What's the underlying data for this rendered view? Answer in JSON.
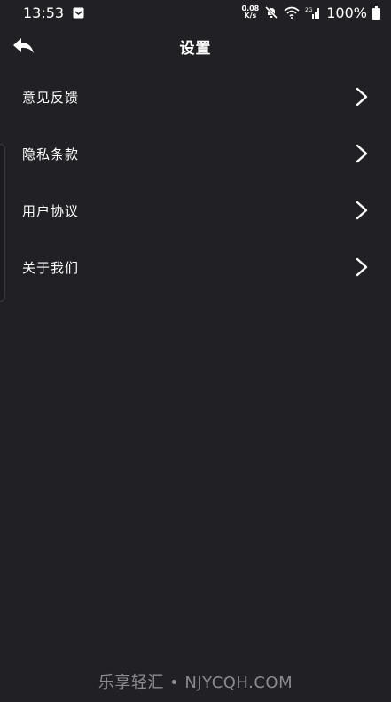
{
  "status_bar": {
    "time": "13:53",
    "net_speed_value": "0.08",
    "net_speed_unit": "K/s",
    "network_type": "2G",
    "battery": "100%"
  },
  "header": {
    "title": "设置"
  },
  "settings": {
    "items": [
      {
        "label": "意见反馈"
      },
      {
        "label": "隐私条款"
      },
      {
        "label": "用户协议"
      },
      {
        "label": "关于我们"
      }
    ]
  },
  "watermark": {
    "text": "乐享轻汇 • NJYCQH.COM"
  },
  "colors": {
    "background": "#202025",
    "text": "#ffffff",
    "watermark": "#8a8a90"
  }
}
